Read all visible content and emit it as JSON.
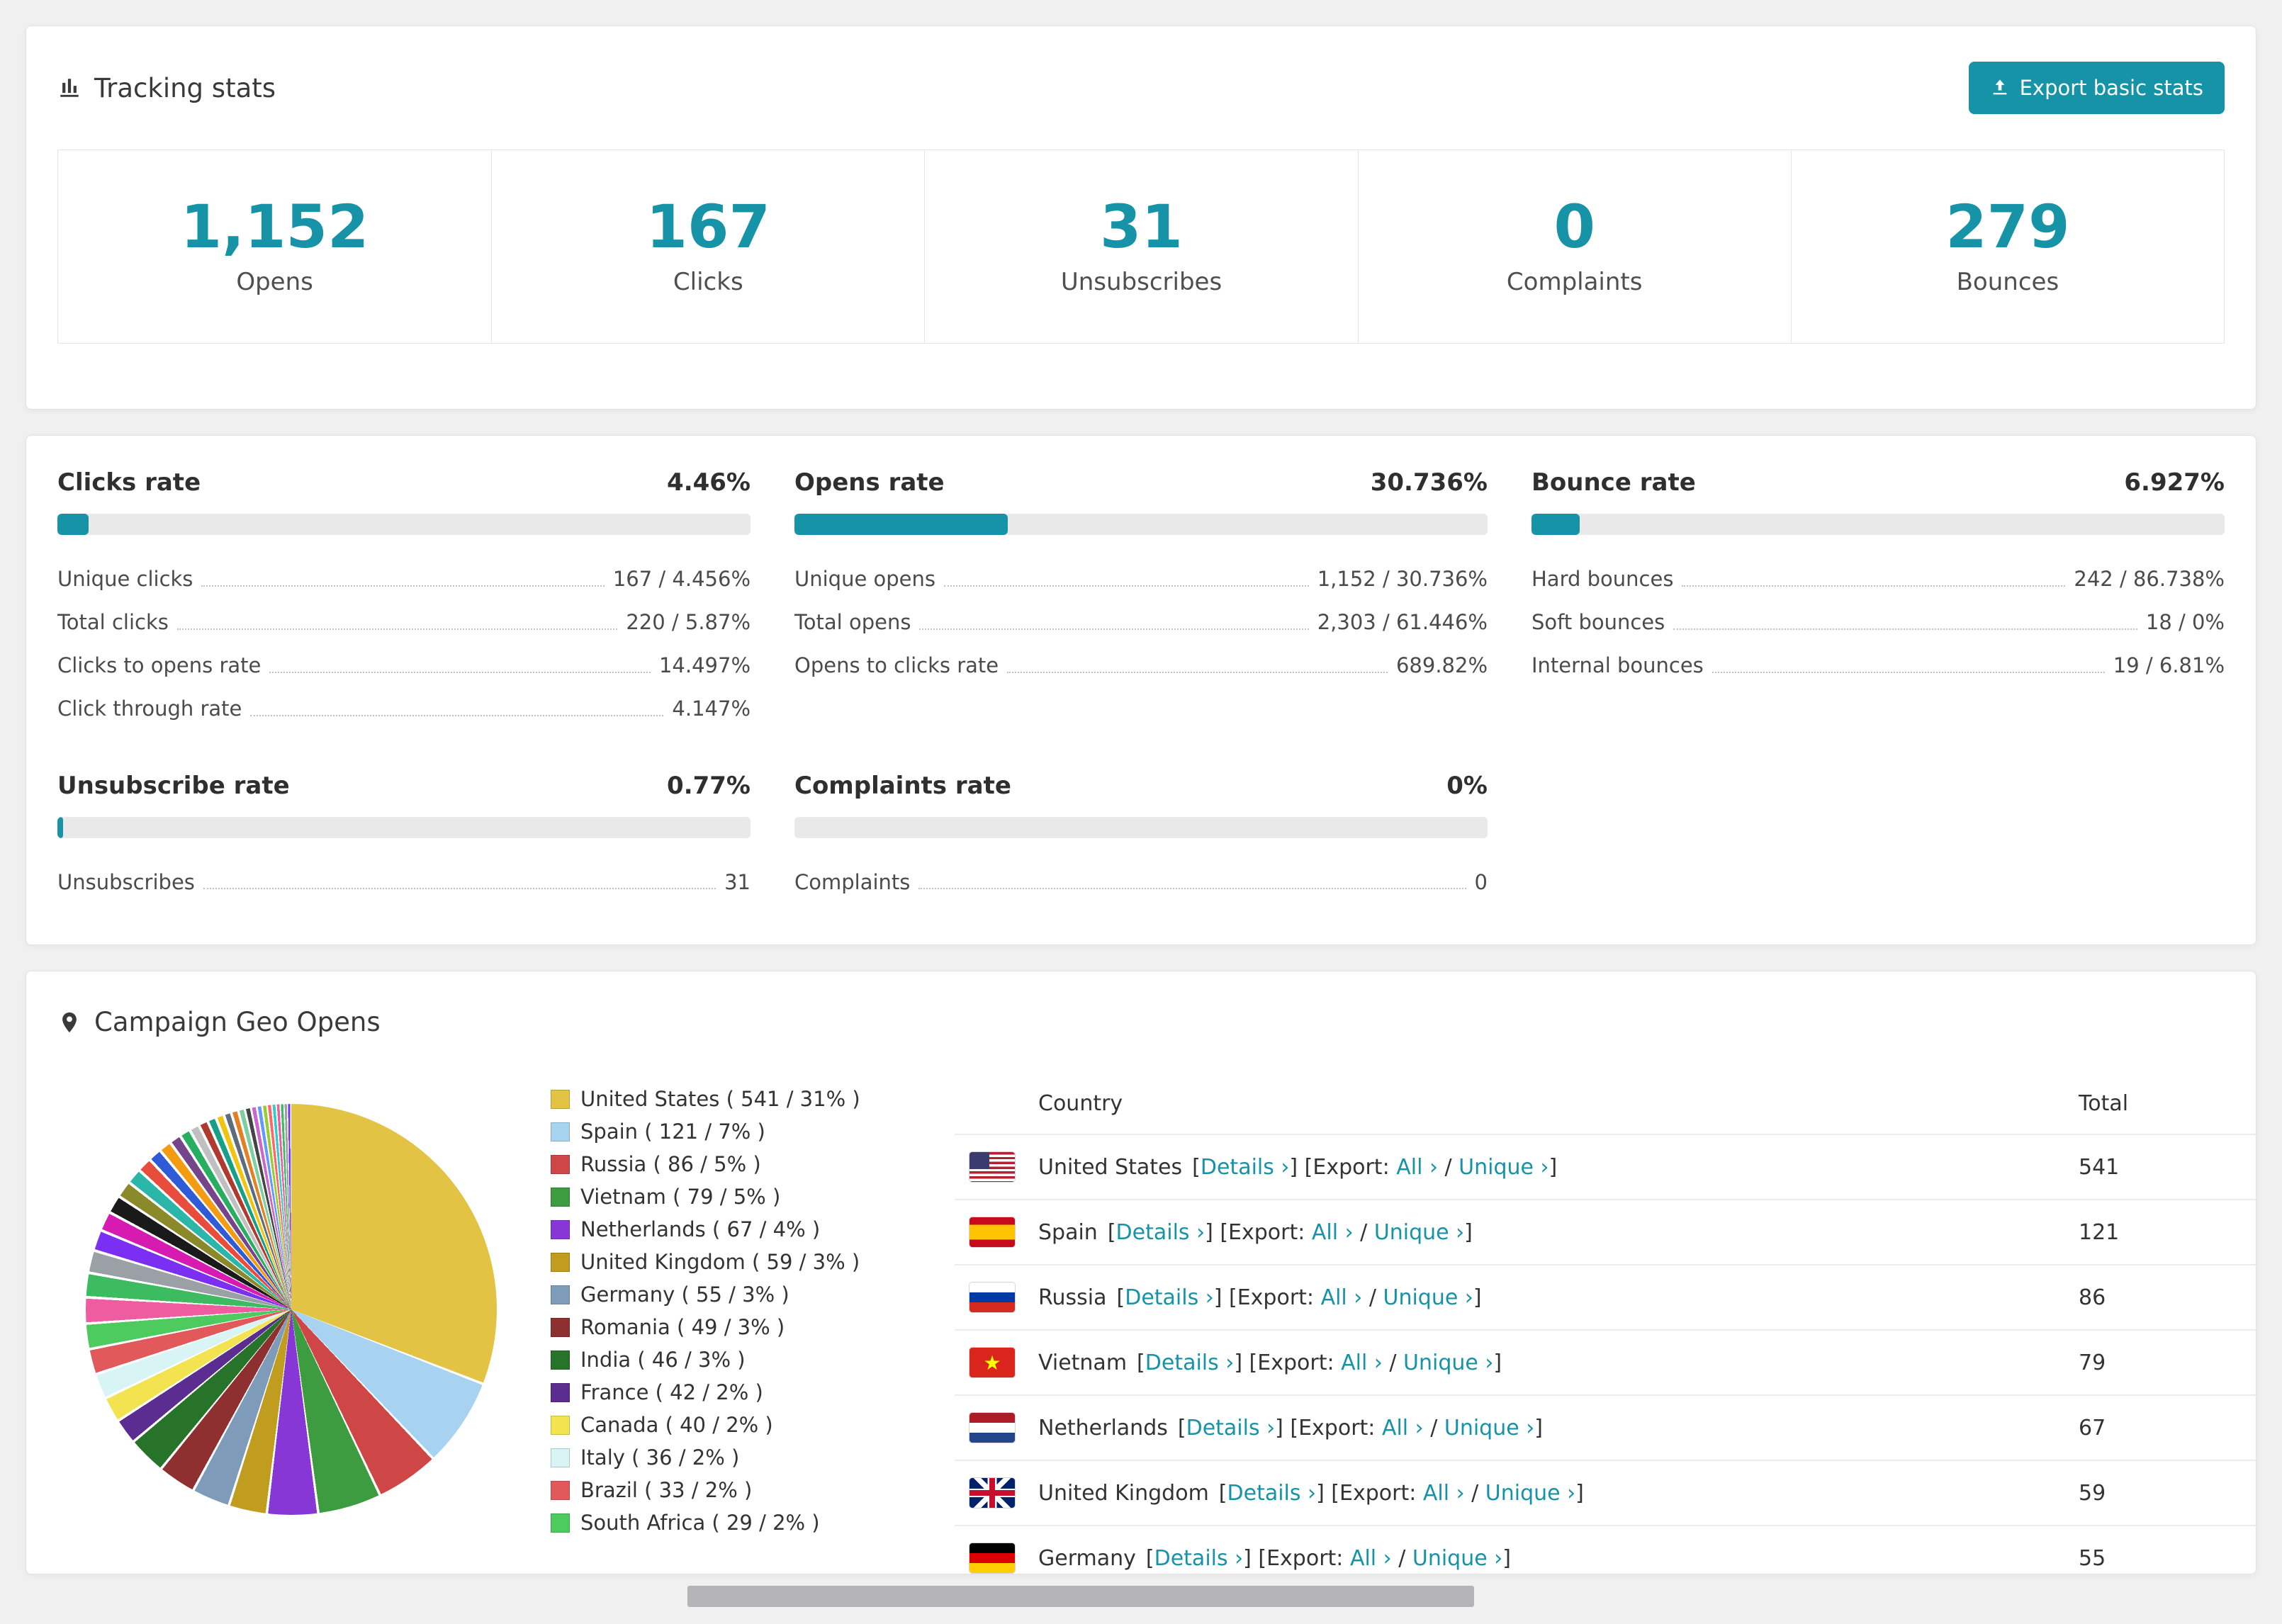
{
  "colors": {
    "accent": "#1693a7",
    "bar_track": "#e9e9ea"
  },
  "tracking": {
    "title": "Tracking stats",
    "export_label": "Export basic stats",
    "stats": [
      {
        "value": "1,152",
        "label": "Opens"
      },
      {
        "value": "167",
        "label": "Clicks"
      },
      {
        "value": "31",
        "label": "Unsubscribes"
      },
      {
        "value": "0",
        "label": "Complaints"
      },
      {
        "value": "279",
        "label": "Bounces"
      }
    ]
  },
  "rates": [
    {
      "title": "Clicks rate",
      "value": "4.46%",
      "percent": 4.46,
      "rows": [
        {
          "label": "Unique clicks",
          "value": "167 / 4.456%"
        },
        {
          "label": "Total clicks",
          "value": "220 / 5.87%"
        },
        {
          "label": "Clicks to opens rate",
          "value": "14.497%"
        },
        {
          "label": "Click through rate",
          "value": "4.147%"
        }
      ]
    },
    {
      "title": "Opens rate",
      "value": "30.736%",
      "percent": 30.736,
      "rows": [
        {
          "label": "Unique opens",
          "value": "1,152 / 30.736%"
        },
        {
          "label": "Total opens",
          "value": "2,303 / 61.446%"
        },
        {
          "label": "Opens to clicks rate",
          "value": "689.82%"
        }
      ]
    },
    {
      "title": "Bounce rate",
      "value": "6.927%",
      "percent": 6.927,
      "rows": [
        {
          "label": "Hard bounces",
          "value": "242 / 86.738%"
        },
        {
          "label": "Soft bounces",
          "value": "18 / 0%"
        },
        {
          "label": "Internal bounces",
          "value": "19 / 6.81%"
        }
      ]
    },
    {
      "title": "Unsubscribe rate",
      "value": "0.77%",
      "percent": 0.77,
      "rows": [
        {
          "label": "Unsubscribes",
          "value": "31"
        }
      ]
    },
    {
      "title": "Complaints rate",
      "value": "0%",
      "percent": 0,
      "rows": [
        {
          "label": "Complaints",
          "value": "0"
        }
      ]
    }
  ],
  "geo": {
    "title": "Campaign Geo Opens",
    "table": {
      "headers": [
        "Country",
        "Total"
      ],
      "details_label": "Details",
      "export_label": "Export:",
      "all_label": "All",
      "unique_label": "Unique",
      "rows": [
        {
          "country": "United States",
          "flag": "us",
          "total": "541"
        },
        {
          "country": "Spain",
          "flag": "es",
          "total": "121"
        },
        {
          "country": "Russia",
          "flag": "ru",
          "total": "86"
        },
        {
          "country": "Vietnam",
          "flag": "vn",
          "total": "79"
        },
        {
          "country": "Netherlands",
          "flag": "nl",
          "total": "67"
        },
        {
          "country": "United Kingdom",
          "flag": "gb",
          "total": "59"
        },
        {
          "country": "Germany",
          "flag": "de",
          "total": "55"
        }
      ]
    }
  },
  "chart_data": {
    "type": "pie",
    "title": "Campaign Geo Opens",
    "legend_position": "right",
    "labels": [
      "United States",
      "Spain",
      "Russia",
      "Vietnam",
      "Netherlands",
      "United Kingdom",
      "Germany",
      "Romania",
      "India",
      "France",
      "Canada",
      "Italy",
      "Brazil",
      "South Africa"
    ],
    "values": [
      541,
      121,
      86,
      79,
      67,
      59,
      55,
      49,
      46,
      42,
      40,
      36,
      33,
      29
    ],
    "percents": [
      31,
      7,
      5,
      5,
      4,
      3,
      3,
      3,
      3,
      2,
      2,
      2,
      2,
      2
    ],
    "colors": [
      "#e2c344",
      "#a8d3f0",
      "#cf4647",
      "#3d9c40",
      "#8637d6",
      "#c09c1f",
      "#7e9cba",
      "#8e3030",
      "#27732a",
      "#5b2d91",
      "#f3e351",
      "#d8f4f4",
      "#e2595c",
      "#4ecb5e"
    ],
    "others": {
      "percent": 26,
      "slice_count": 30,
      "palette": [
        "#ef5da0",
        "#3dbb61",
        "#9aa0a6",
        "#7b2ff2",
        "#d81bb0",
        "#1a1a1a",
        "#8a8a2a",
        "#2ab7a9",
        "#e74c3c",
        "#2f5bd6",
        "#f39c12",
        "#76448a",
        "#27ae60",
        "#c0c0c0",
        "#b03a2e",
        "#16a085",
        "#f1c40f",
        "#5d6d7e",
        "#e67e22",
        "#7dcea0",
        "#444444",
        "#cc66cc",
        "#6699ff",
        "#99cc33",
        "#ff6666",
        "#33cccc"
      ]
    }
  }
}
